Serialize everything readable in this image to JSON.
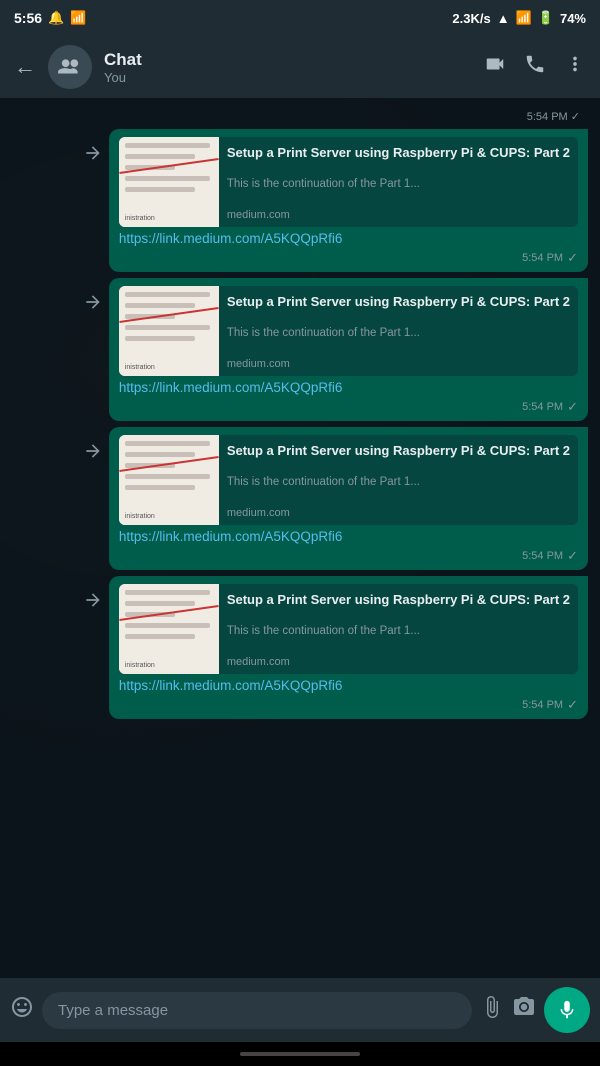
{
  "statusBar": {
    "time": "5:56",
    "network": "2.3K/s",
    "battery": "74%"
  },
  "header": {
    "title": "Chat",
    "subtitle": "You",
    "backLabel": "←",
    "videoCallLabel": "video-call",
    "callLabel": "phone-call",
    "menuLabel": "more-options"
  },
  "messages": [
    {
      "id": 1,
      "time": "5:54 PM",
      "link": "https://link.medium.com/A5KQQpRfi6",
      "previewTitle": "Setup a Print Server using Raspberry Pi & CUPS: Part 2",
      "previewDesc": "This is the continuation of the Part 1...",
      "previewDomain": "medium.com"
    },
    {
      "id": 2,
      "time": "5:54 PM",
      "link": "https://link.medium.com/A5KQQpRfi6",
      "previewTitle": "Setup a Print Server using Raspberry Pi & CUPS: Part 2",
      "previewDesc": "This is the continuation of the Part 1...",
      "previewDomain": "medium.com"
    },
    {
      "id": 3,
      "time": "5:54 PM",
      "link": "https://link.medium.com/A5KQQpRfi6",
      "previewTitle": "Setup a Print Server using Raspberry Pi & CUPS: Part 2",
      "previewDesc": "This is the continuation of the Part 1...",
      "previewDomain": "medium.com"
    },
    {
      "id": 4,
      "time": "5:54 PM",
      "link": "https://link.medium.com/A5KQQpRfi6",
      "previewTitle": "Setup a Print Server using Raspberry Pi & CUPS: Part 2",
      "previewDesc": "This is the continuation of the Part 1...",
      "previewDomain": "medium.com"
    }
  ],
  "inputBar": {
    "placeholder": "Type a message",
    "emojiLabel": "emoji",
    "attachLabel": "attach",
    "cameraLabel": "camera",
    "micLabel": "microphone"
  }
}
